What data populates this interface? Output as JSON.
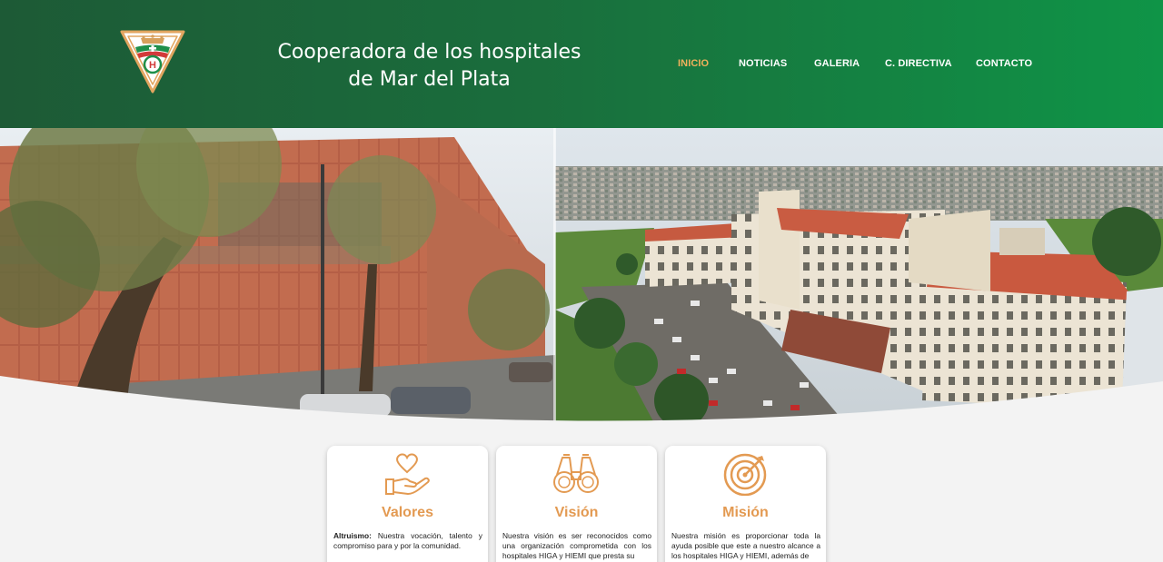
{
  "header": {
    "title_line1": "Cooperadora de los hospitales",
    "title_line2": "de Mar del Plata",
    "logo_letter": "H"
  },
  "nav": {
    "items": [
      {
        "label": "INICIO",
        "active": true
      },
      {
        "label": "NOTICIAS",
        "active": false
      },
      {
        "label": "GALERIA",
        "active": false
      },
      {
        "label": "C. DIRECTIVA",
        "active": false
      },
      {
        "label": "CONTACTO",
        "active": false
      }
    ]
  },
  "cards": [
    {
      "title": "Valores",
      "icon": "heart-hand-icon",
      "lead": "Altruismo:",
      "text": " Nuestra vocación, talento y compromiso para y por la comunidad."
    },
    {
      "title": "Visión",
      "icon": "binoculars-icon",
      "lead": "",
      "text": "Nuestra visión es ser reconocidos como una organización comprometida con los hospitales HIGA y HIEMI que presta su"
    },
    {
      "title": "Misión",
      "icon": "target-icon",
      "lead": "",
      "text": "Nuestra misión es proporcionar toda la ayuda posible que este a nuestro alcance a los hospitales HIGA y HIEMI, además de"
    }
  ],
  "colors": {
    "header_green_dark": "#1d5a36",
    "header_green_light": "#0f9447",
    "accent_orange": "#e39a52",
    "nav_active": "#f0b15c"
  }
}
